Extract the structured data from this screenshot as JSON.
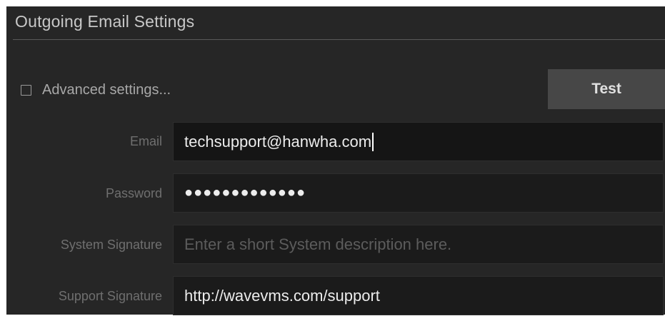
{
  "section": {
    "title": "Outgoing Email Settings"
  },
  "advanced": {
    "checked": false,
    "label": "Advanced settings..."
  },
  "test_button": {
    "label": "Test"
  },
  "fields": {
    "email": {
      "label": "Email",
      "value": "techsupport@hanwha.com"
    },
    "password": {
      "label": "Password",
      "value": "●●●●●●●●●●●●●"
    },
    "system_signature": {
      "label": "System Signature",
      "value": "",
      "placeholder": "Enter a short System description here."
    },
    "support_signature": {
      "label": "Support Signature",
      "value": "http://wavevms.com/support"
    }
  }
}
